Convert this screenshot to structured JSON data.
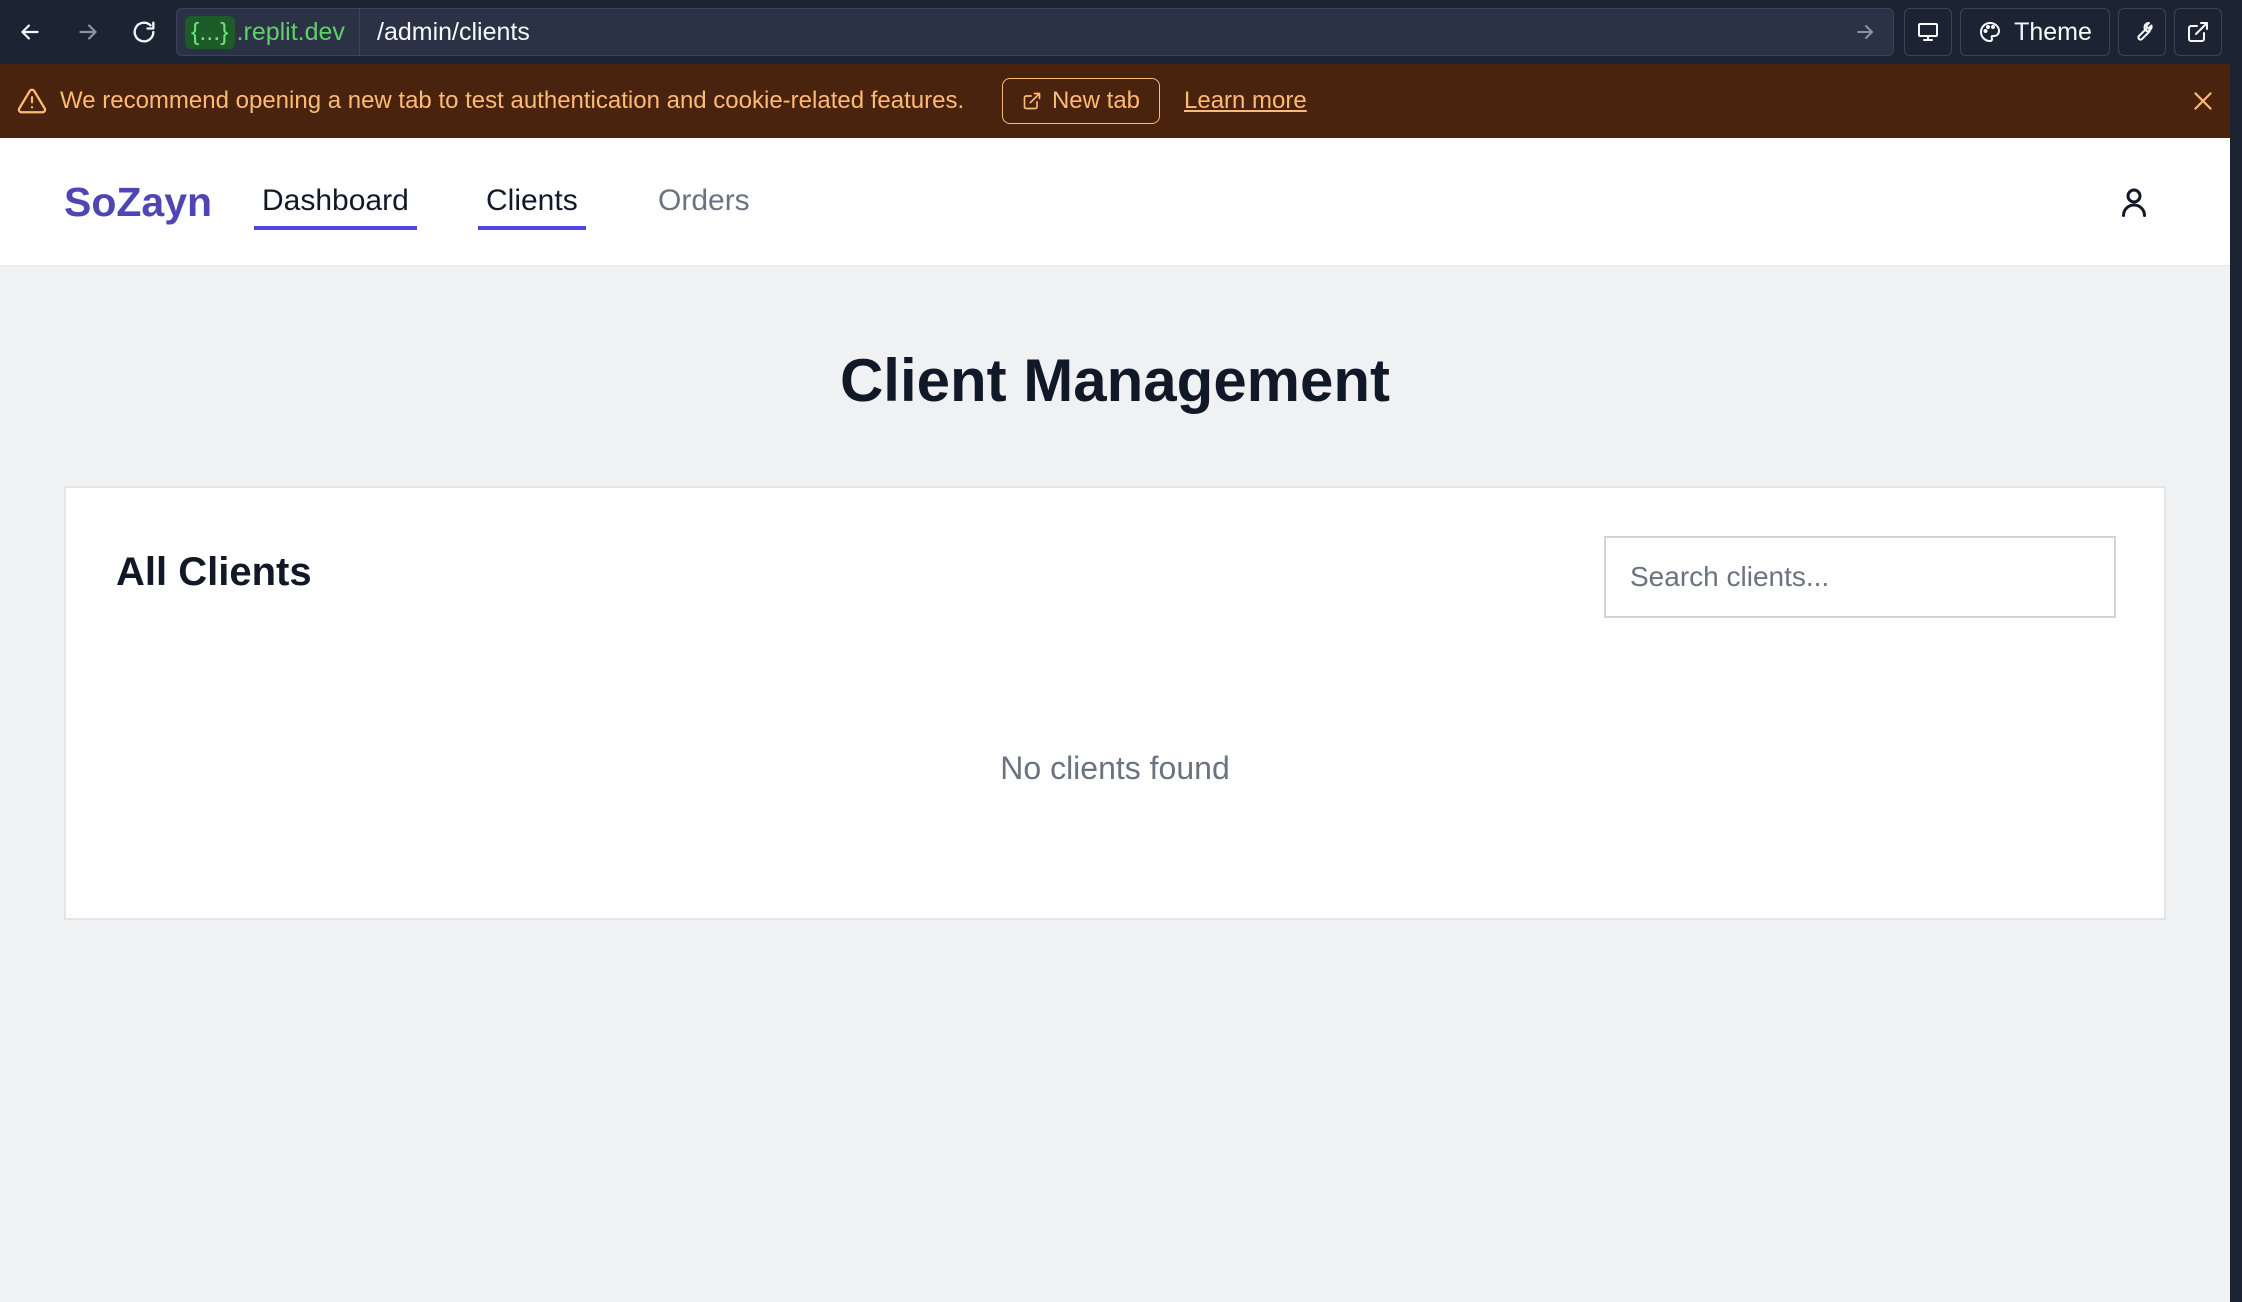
{
  "browser": {
    "url_host_brace": "{...}",
    "url_host": ".replit.dev",
    "url_path": "/admin/clients",
    "theme_label": "Theme"
  },
  "banner": {
    "message": "We recommend opening a new tab to test authentication and cookie-related features.",
    "new_tab_label": "New tab",
    "learn_more_label": "Learn more"
  },
  "header": {
    "brand": "SoZayn",
    "nav": [
      {
        "label": "Dashboard",
        "active": true
      },
      {
        "label": "Clients",
        "active": true
      },
      {
        "label": "Orders",
        "active": false
      }
    ]
  },
  "main": {
    "title": "Client Management",
    "card_title": "All Clients",
    "search_placeholder": "Search clients...",
    "search_value": "",
    "empty_message": "No clients found"
  },
  "colors": {
    "brand": "#4f46b5",
    "accent": "#4f46e5",
    "banner_bg": "#4a230e",
    "banner_text": "#fdba74",
    "chrome_bg": "#1c2333"
  },
  "icons": [
    "back-arrow-icon",
    "forward-arrow-icon",
    "reload-icon",
    "go-arrow-icon",
    "monitor-icon",
    "palette-icon",
    "wrench-icon",
    "external-link-icon",
    "warning-icon",
    "close-icon",
    "user-icon"
  ]
}
